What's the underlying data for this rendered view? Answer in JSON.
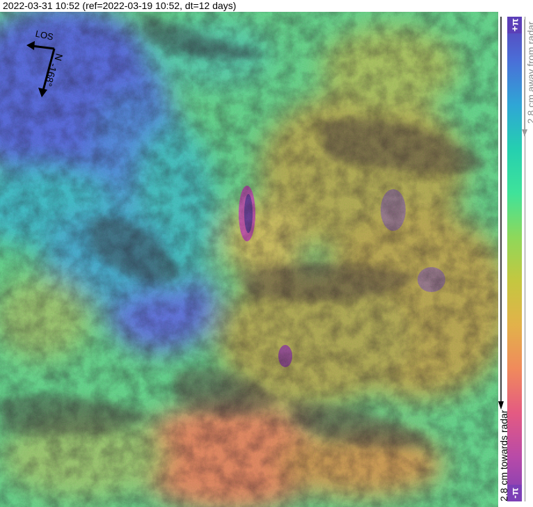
{
  "title": "2022-03-31 10:52 (ref=2022-03-19 10:52, dt=12 days)",
  "compass": {
    "los_label": "LOS",
    "north_label": "N",
    "heading_label": "-168°"
  },
  "colorbar": {
    "top_symbol": "+π",
    "bottom_symbol": "-π",
    "away_label": "2.8 cm away from radar",
    "towards_label": "2.8 cm towards radar",
    "colors": [
      "#5b3fb8",
      "#4a6fd8",
      "#2fa6d6",
      "#25cfb0",
      "#3fe39a",
      "#8ed85a",
      "#c4c740",
      "#e2b24a",
      "#f08a5c",
      "#e45a82",
      "#b84aa8",
      "#7c3fb6"
    ]
  },
  "map_colors": {
    "blue_region": "#3f66d8",
    "cyan_region": "#27c6c0",
    "green_region": "#4fe07a",
    "olive_region": "#a9b23a",
    "orange_region": "#e0884a",
    "shadow": "#3a3a20"
  }
}
